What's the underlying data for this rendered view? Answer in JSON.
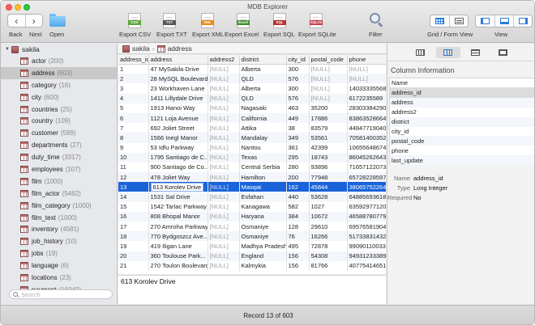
{
  "window": {
    "title": "MDB Explorer"
  },
  "toolbar": {
    "back_label": "Back",
    "next_label": "Next",
    "open_label": "Open",
    "exports": [
      {
        "label": "Export CSV",
        "tag": "CSV",
        "color": "#5aa63a"
      },
      {
        "label": "Export TXT",
        "tag": "TXT",
        "color": "#555555"
      },
      {
        "label": "Export XML",
        "tag": "XML",
        "color": "#e88a1a"
      },
      {
        "label": "Export Excel",
        "tag": "Excel",
        "color": "#3f8f2e"
      },
      {
        "label": "Export SQL",
        "tag": "SQL",
        "color": "#b43030"
      },
      {
        "label": "Export SQLite",
        "tag": "SQLite",
        "color": "#c53b4a"
      }
    ],
    "filter_label": "Filter",
    "grid_form_label": "Grid / Form View",
    "view_label": "View"
  },
  "sidebar": {
    "database": "sakila",
    "tables": [
      {
        "name": "actor",
        "count": "(200)"
      },
      {
        "name": "address",
        "count": "(603)",
        "selected": true
      },
      {
        "name": "category",
        "count": "(16)"
      },
      {
        "name": "city",
        "count": "(600)"
      },
      {
        "name": "countries",
        "count": "(25)"
      },
      {
        "name": "country",
        "count": "(109)"
      },
      {
        "name": "customer",
        "count": "(599)"
      },
      {
        "name": "departments",
        "count": "(27)"
      },
      {
        "name": "duty_time",
        "count": "(3317)"
      },
      {
        "name": "employees",
        "count": "(107)"
      },
      {
        "name": "film",
        "count": "(1000)"
      },
      {
        "name": "film_actor",
        "count": "(5462)"
      },
      {
        "name": "film_category",
        "count": "(1000)"
      },
      {
        "name": "film_text",
        "count": "(1000)"
      },
      {
        "name": "inventory",
        "count": "(4581)"
      },
      {
        "name": "job_history",
        "count": "(10)"
      },
      {
        "name": "jobs",
        "count": "(19)"
      },
      {
        "name": "language",
        "count": "(6)"
      },
      {
        "name": "locations",
        "count": "(23)"
      },
      {
        "name": "payment",
        "count": "(16049)"
      }
    ],
    "search_placeholder": "Search"
  },
  "path": {
    "db": "sakila",
    "table": "address"
  },
  "grid": {
    "columns": [
      "address_id",
      "address",
      "address2",
      "district",
      "city_id",
      "postal_code",
      "phone"
    ],
    "rows": [
      [
        "1",
        "47 MySakila Drive",
        "[NULL]",
        "Alberta",
        "300",
        "[NULL]",
        "[NULL]"
      ],
      [
        "2",
        "28 MySQL Boulevard",
        "[NULL]",
        "QLD",
        "576",
        "[NULL]",
        "[NULL]"
      ],
      [
        "3",
        "23 Workhaven Lane",
        "[NULL]",
        "Alberta",
        "300",
        "[NULL]",
        "14033335568"
      ],
      [
        "4",
        "1411 Lillydale Drive",
        "[NULL]",
        "QLD",
        "576",
        "[NULL]",
        "6172235589"
      ],
      [
        "5",
        "1913 Hanoi Way",
        "[NULL]",
        "Nagasaki",
        "463",
        "35200",
        "28303384290"
      ],
      [
        "6",
        "1121 Loja Avenue",
        "[NULL]",
        "California",
        "449",
        "17886",
        "83863528664"
      ],
      [
        "7",
        "692 Joliet Street",
        "[NULL]",
        "Attika",
        "38",
        "83579",
        "44847719040"
      ],
      [
        "8",
        "1566 Inegl Manor",
        "[NULL]",
        "Mandalay",
        "349",
        "53561",
        "70581400352"
      ],
      [
        "9",
        "53 Idfu Parkway",
        "[NULL]",
        "Nantou",
        "361",
        "42399",
        "10655648674"
      ],
      [
        "10",
        "1795 Santiago de C...",
        "[NULL]",
        "Texas",
        "295",
        "18743",
        "86045262643"
      ],
      [
        "11",
        "900 Santiago de Co...",
        "[NULL]",
        "Central Serbia",
        "280",
        "93896",
        "71657122073"
      ],
      [
        "12",
        "478 Joliet Way",
        "[NULL]",
        "Hamilton",
        "200",
        "77948",
        "65728228597"
      ],
      [
        "13",
        "613 Korolev Drive",
        "[NULL]",
        "Masqat",
        "162",
        "45844",
        "38065752264"
      ],
      [
        "14",
        "1531 Sal Drive",
        "[NULL]",
        "Esfahan",
        "440",
        "53628",
        "64885693618"
      ],
      [
        "15",
        "1542 Tarlac Parkway",
        "[NULL]",
        "Kanagawa",
        "582",
        "1027",
        "63592977120"
      ],
      [
        "16",
        "808 Bhopal Manor",
        "[NULL]",
        "Haryana",
        "384",
        "10672",
        "46588780779"
      ],
      [
        "17",
        "270 Amroha Parkway",
        "[NULL]",
        "Osmaniye",
        "128",
        "29610",
        "69576581904"
      ],
      [
        "18",
        "770 Bydgoszcz Ave...",
        "[NULL]",
        "Osmaniye",
        "76",
        "16266",
        "51733831432"
      ],
      [
        "19",
        "419 Iligan Lane",
        "[NULL]",
        "Madhya Pradesh",
        "495",
        "72878",
        "99090110033"
      ],
      [
        "20",
        "360 Toulouse Park...",
        "[NULL]",
        "England",
        "156",
        "54308",
        "94931233389"
      ],
      [
        "21",
        "270 Toulon Boulevard",
        "[NULL]",
        "Kalmykia",
        "156",
        "81766",
        "40775414651"
      ]
    ],
    "selected_index": 12
  },
  "cell_value": "613 Korolev Drive",
  "right_pane": {
    "header": "Column Information",
    "list_header": "Name",
    "columns": [
      "address_id",
      "address",
      "address2",
      "district",
      "city_id",
      "postal_code",
      "phone",
      "last_update"
    ],
    "selected_index": 0,
    "props": [
      {
        "k": "Name",
        "v": "address_id"
      },
      {
        "k": "Type",
        "v": "Long Integer"
      },
      {
        "k": "Required",
        "v": "No"
      }
    ]
  },
  "status": {
    "text": "Record 13 of 603"
  }
}
